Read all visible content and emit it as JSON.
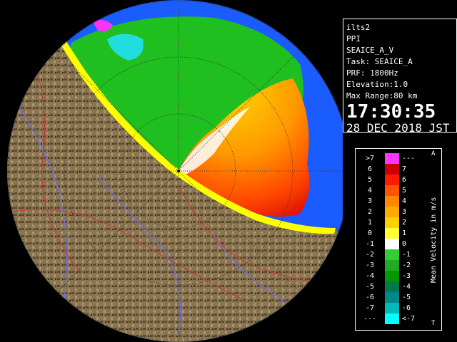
{
  "info": {
    "site": "ilts2",
    "product": "PPI",
    "product_field": "SEAICE_A_V",
    "task": "Task: SEAICE_A",
    "prf": "PRF: 1800Hz",
    "elevation": "Elevation:1.0",
    "max_range": "Max Range:80 km",
    "time": "17:30:35",
    "date": "28 DEC 2018 JST"
  },
  "legend": {
    "unit_label": "Mean Velocity in m/s",
    "away_tag": "A",
    "toward_tag": "T",
    "rows": [
      {
        "lo": ">7",
        "hi": "---",
        "color": "#ff33ff"
      },
      {
        "lo": "6",
        "hi": "7",
        "color": "#cc0000"
      },
      {
        "lo": "5",
        "hi": "6",
        "color": "#ff1a00"
      },
      {
        "lo": "4",
        "hi": "5",
        "color": "#ff5500"
      },
      {
        "lo": "3",
        "hi": "4",
        "color": "#ff8800"
      },
      {
        "lo": "2",
        "hi": "3",
        "color": "#ffaa00"
      },
      {
        "lo": "1",
        "hi": "2",
        "color": "#ffd000"
      },
      {
        "lo": "0",
        "hi": "1",
        "color": "#ffff33"
      },
      {
        "lo": "-1",
        "hi": "0",
        "color": "#ffffff"
      },
      {
        "lo": "-2",
        "hi": "-1",
        "color": "#33cc33"
      },
      {
        "lo": "-3",
        "hi": "-2",
        "color": "#22aa22"
      },
      {
        "lo": "-4",
        "hi": "-3",
        "color": "#009900"
      },
      {
        "lo": "-5",
        "hi": "-4",
        "color": "#007a4a"
      },
      {
        "lo": "-6",
        "hi": "-5",
        "color": "#008888"
      },
      {
        "lo": "-7",
        "hi": "-6",
        "color": "#00bbbb"
      },
      {
        "lo": "---",
        "hi": "<-7",
        "color": "#00ffff"
      }
    ]
  },
  "colors": {
    "beyond_range": "#1a5cff",
    "land": "#8a7550",
    "rivers": "#6b6bff",
    "roads": "#cc3333",
    "sea_ice_coast": "#ffff00"
  }
}
